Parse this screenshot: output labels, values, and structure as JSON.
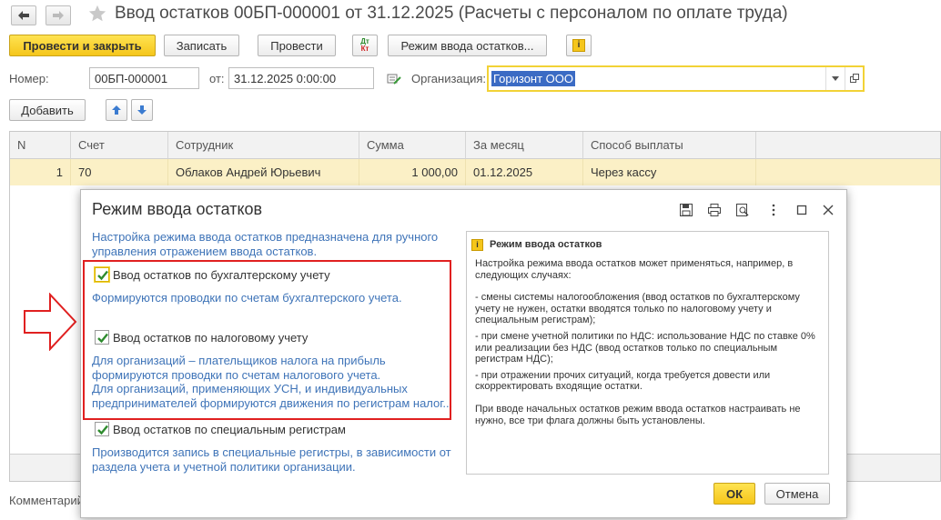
{
  "window": {
    "title": "Ввод остатков 00БП-000001 от 31.12.2025 (Расчеты с персоналом по оплате труда)"
  },
  "toolbar": {
    "post_close": "Провести и закрыть",
    "save": "Записать",
    "post": "Провести",
    "dt_kt_top": "Дт",
    "dt_kt_bottom": "Кт",
    "mode": "Режим ввода остатков...",
    "info": "i"
  },
  "form": {
    "number_label": "Номер:",
    "number_value": "00БП-000001",
    "date_label": "от:",
    "date_value": "31.12.2025  0:00:00",
    "org_label": "Организация:",
    "org_value": "Горизонт ООО"
  },
  "table_toolbar": {
    "add": "Добавить"
  },
  "table": {
    "columns": [
      "N",
      "Счет",
      "Сотрудник",
      "Сумма",
      "За месяц",
      "Способ выплаты"
    ],
    "rows": [
      {
        "n": "1",
        "account": "70",
        "employee": "Облаков Андрей Юрьевич",
        "sum": "1 000,00",
        "month": "01.12.2025",
        "payment": "Через кассу"
      }
    ]
  },
  "comment_label": "Комментарий",
  "dialog": {
    "title": "Режим ввода остатков",
    "intro": [
      "Настройка режима ввода остатков предназначена для ручного",
      "управления отражением  ввода остатков."
    ],
    "accounting": {
      "label": "Ввод остатков по бухгалтерскому учету",
      "desc": "Формируются проводки по счетам бухгалтерского учета.",
      "checked": true
    },
    "tax": {
      "label": "Ввод остатков по налоговому учету",
      "desc": [
        "Для организаций – плательщиков налога на прибыль",
        "формируются проводки по счетам налогового учета.",
        "Для организаций, применяющих УСН, и  индивидуальных",
        "предпринимателей формируются движения по регистрам налог..."
      ],
      "checked": true
    },
    "special": {
      "label": "Ввод остатков по специальным регистрам",
      "desc": [
        "Производится запись в специальные регистры, в зависимости от",
        "раздела учета и учетной политики организации."
      ],
      "checked": true
    },
    "help": {
      "title": "Режим ввода остатков",
      "p1": [
        "Настройка режима ввода остатков может применяться, например, в",
        "следующих случаях:"
      ],
      "p2": [
        "- смены системы налогообложения (ввод остатков по бухгалтерскому",
        "учету не нужен, остатки вводятся только по налоговому учету и",
        "специальным регистрам);"
      ],
      "p3": [
        "- при смене учетной политики по НДС: использование НДС по ставке 0%",
        "или реализации без НДС (ввод остатков только по специальным",
        "регистрам НДС);"
      ],
      "p4": [
        "- при отражении прочих ситуаций, когда требуется довести или",
        "скорректировать входящие остатки."
      ],
      "p5": [
        "При вводе начальных остатков режим ввода остатков настраивать не",
        "нужно, все три флага должны быть установлены."
      ]
    },
    "ok": "ОК",
    "cancel": "Отмена"
  }
}
